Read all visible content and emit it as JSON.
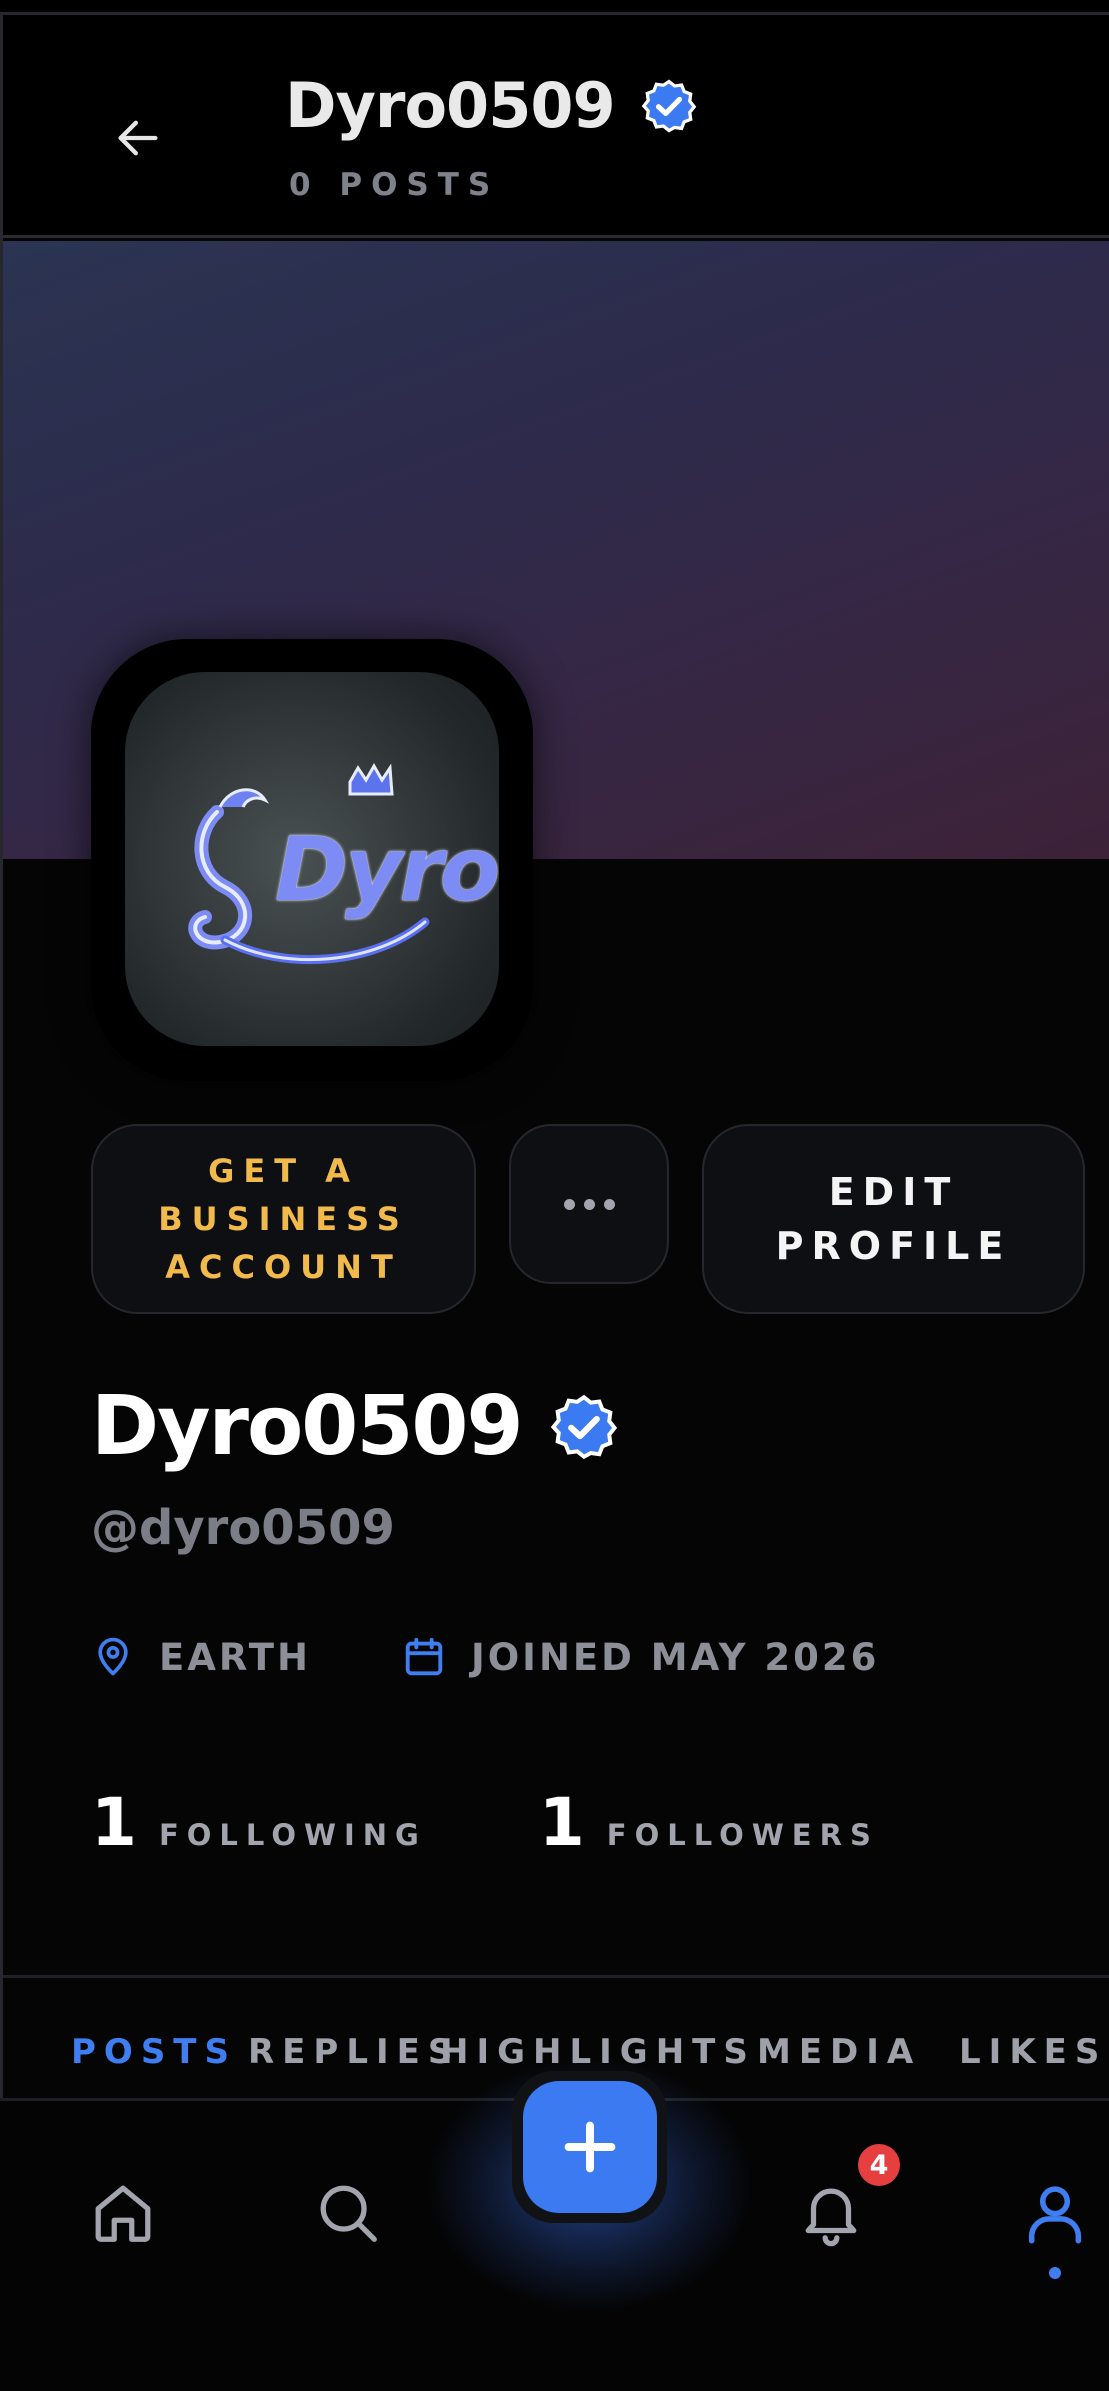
{
  "header": {
    "back_icon": "arrow-left-icon",
    "title": "Dyro0509",
    "verified_icon": "verified-badge-icon",
    "subtitle": "0 POSTS"
  },
  "profile": {
    "avatar_text": "Dyro",
    "display_name": "Dyro0509",
    "handle": "@dyro0509",
    "location": "EARTH",
    "location_icon": "map-pin-icon",
    "joined": "JOINED MAY 2026",
    "joined_icon": "calendar-icon",
    "verified_icon": "verified-badge-icon",
    "accent_color": "#3f7ef0"
  },
  "actions": {
    "business_line1": "GET A",
    "business_line2": "BUSINESS",
    "business_line3": "ACCOUNT",
    "more_icon": "more-horizontal-icon",
    "edit_line1": "EDIT",
    "edit_line2": "PROFILE"
  },
  "stats": {
    "following_count": "1",
    "following_label": "FOLLOWING",
    "followers_count": "1",
    "followers_label": "FOLLOWERS"
  },
  "tabs": [
    {
      "label": "POSTS",
      "active": true
    },
    {
      "label": "REPLIES",
      "active": false
    },
    {
      "label": "HIGHLIGHTS",
      "active": false
    },
    {
      "label": "MEDIA",
      "active": false
    },
    {
      "label": "LIKES",
      "active": false
    }
  ],
  "bottom_nav": {
    "home_icon": "home-icon",
    "search_icon": "search-icon",
    "compose_icon": "plus-icon",
    "notifications_icon": "bell-icon",
    "notifications_badge": "4",
    "profile_icon": "user-icon"
  }
}
